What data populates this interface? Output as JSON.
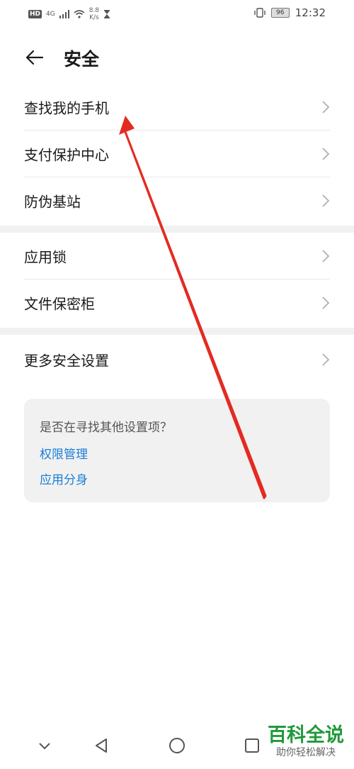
{
  "status_bar": {
    "network_badge": "HD",
    "network_type": "4G",
    "speed_value": "8.8",
    "speed_unit": "K/s",
    "battery": "96",
    "time": "12:32"
  },
  "header": {
    "title": "安全"
  },
  "group1": [
    {
      "label": "查找我的手机"
    },
    {
      "label": "支付保护中心"
    },
    {
      "label": "防伪基站"
    }
  ],
  "group2": [
    {
      "label": "应用锁"
    },
    {
      "label": "文件保密柜"
    }
  ],
  "group3": [
    {
      "label": "更多安全设置"
    }
  ],
  "suggestion_card": {
    "question": "是否在寻找其他设置项？",
    "links": [
      "权限管理",
      "应用分身"
    ]
  },
  "watermark": {
    "main": "百科全说",
    "sub": "助你轻松解决"
  },
  "colors": {
    "link": "#1a7fd6",
    "annotation_arrow": "#e32b22",
    "watermark": "#1f9a3a"
  }
}
